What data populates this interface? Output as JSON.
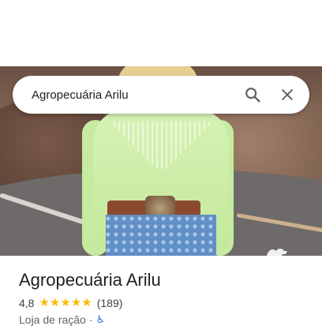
{
  "search": {
    "query": "Agropecuária Arilu",
    "search_icon": "search-icon",
    "close_icon": "close-icon"
  },
  "place": {
    "name": "Agropecuária Arilu",
    "rating": "4,8",
    "stars_filled": 5,
    "reviews_count": "(189)",
    "category": "Loja de ração",
    "separator": "·",
    "accessibility_icon": "wheelchair-icon"
  },
  "colors": {
    "star": "#fbbc04",
    "accessibility": "#1a73e8",
    "text_primary": "#202124"
  }
}
